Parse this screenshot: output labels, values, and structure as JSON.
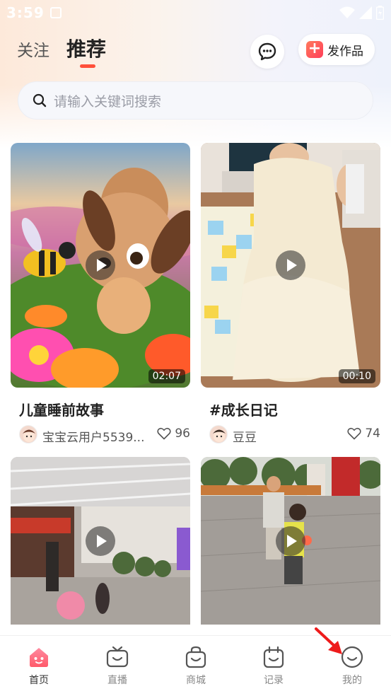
{
  "status_bar": {
    "time": "3:59"
  },
  "header": {
    "tabs": [
      {
        "label": "关注",
        "active": false
      },
      {
        "label": "推荐",
        "active": true
      }
    ],
    "message_icon": "chat-bubble-icon",
    "publish_label": "发作品"
  },
  "search": {
    "placeholder": "请输入关键词搜索"
  },
  "feed": [
    {
      "title": "儿童睡前故事",
      "author": "宝宝云用户5539...",
      "likes": "96",
      "duration": "02:07"
    },
    {
      "title": "#成长日记",
      "author": "豆豆",
      "likes": "74",
      "duration": "00:10"
    },
    {
      "title": "",
      "author": "",
      "likes": "",
      "duration": ""
    },
    {
      "title": "",
      "author": "",
      "likes": "",
      "duration": ""
    }
  ],
  "bottom_nav": [
    {
      "label": "首页",
      "icon": "home-icon",
      "active": true
    },
    {
      "label": "直播",
      "icon": "tv-icon",
      "active": false
    },
    {
      "label": "商城",
      "icon": "bag-icon",
      "active": false
    },
    {
      "label": "记录",
      "icon": "calendar-icon",
      "active": false
    },
    {
      "label": "我的",
      "icon": "smile-icon",
      "active": false
    }
  ],
  "colors": {
    "accent": "#ff4f3a",
    "active_nav": "#ff6b6b"
  }
}
